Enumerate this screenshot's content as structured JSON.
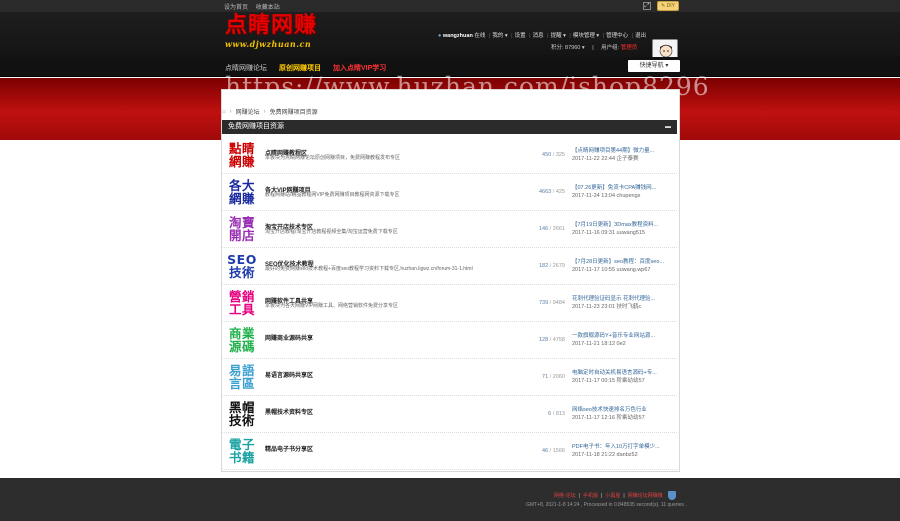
{
  "topbar": {
    "set_home": "设为首页",
    "bookmark": "收藏本站",
    "diy": "DIY"
  },
  "logo": {
    "text": "点睛网赚",
    "url": "www.djwzhuan.cn"
  },
  "user": {
    "username": "wangzhuan",
    "status": "在线",
    "menu": [
      "我的",
      "设置",
      "消息",
      "提醒",
      "模块管理",
      "管理中心",
      "退出"
    ],
    "points_label": "积分: 87960",
    "group_label": "用户组:",
    "group_value": "管理员"
  },
  "nav": {
    "items": [
      "点睛网赚论坛",
      "原创网赚项目",
      "加入点睛VIP学习"
    ],
    "quick_nav": "快捷导航"
  },
  "watermark": "https://www.huzhan.com/ishop8296",
  "breadcrumb": {
    "items": [
      "网赚论坛",
      "免费网赚项目资源"
    ]
  },
  "category": {
    "title": "免费网赚项目资源"
  },
  "forums": [
    {
      "icon_lines": [
        "點睛",
        "網賺"
      ],
      "icon_color": "#cc0000",
      "name": "点睛网赚教程区",
      "desc": "本板块为点睛网赚论坛原创网赚项目，免费网赚教程发布专区",
      "threads": "450",
      "posts": "325",
      "last_title": "【点睛网赚项目第44期】微力量...",
      "last_time": "2017-11-22 22:44 企子泰赛"
    },
    {
      "icon_lines": [
        "各大",
        "網賺"
      ],
      "icon_color": "#1a2aa0",
      "name": "各大VIP网赚项目",
      "desc": "教程网赚站/精品教程网VIP免费网赚项目教程网资源下载专区",
      "threads": "4663",
      "posts": "425",
      "last_title": "【07.26更新】免流卡CPA赚钱网...",
      "last_time": "2017-11-24 13:04 chupengs"
    },
    {
      "icon_lines": [
        "淘寶",
        "開店"
      ],
      "icon_color": "#9a2fb5",
      "name": "淘宝开店技术专区",
      "desc": "淘宝开店教程/淘宝开店教程视频全集/淘宝运营免费下载专区",
      "threads": "146",
      "posts": "2661",
      "last_title": "【7月19日更新】3Dmax教程资料...",
      "last_time": "2017-11-16 09:31 uuwang515"
    },
    {
      "icon_lines": [
        "SEO",
        "技術"
      ],
      "icon_color": "#1f3cad",
      "name": "SEO优化技术教程",
      "desc": "最好的免费网赚seo技术教程+百度seo教程学习资料下载专区,huzhan.ligwz.cn/forum-31-1.html",
      "threads": "182",
      "posts": "2679",
      "last_title": "【7月28日更新】seo教程：百度seo...",
      "last_time": "2017-11-17 10:55 uuwang.wp67"
    },
    {
      "icon_lines": [
        "營銷",
        "工具"
      ],
      "icon_color": "#e6007e",
      "name": "网赚软件工具共享",
      "desc": "本板块为各大网赚VIP网赚工具、网络营销软件免费分享专区",
      "threads": "739",
      "posts": "9484",
      "last_title": "花刺代理验证码显示 花刺代理验...",
      "last_time": "2017-11-23 23:01 扶时飞鹤c"
    },
    {
      "icon_lines": [
        "商業",
        "源碼"
      ],
      "icon_color": "#22b14c",
      "name": "网赚商业源码共享",
      "desc": "",
      "threads": "128",
      "posts": "4758",
      "last_title": "一款旗舰源码Y+音乐专业网站源...",
      "last_time": "2017-11-21 18:12 0e2"
    },
    {
      "icon_lines": [
        "易語",
        "言區"
      ],
      "icon_color": "#3aa0d0",
      "name": "易语言源码共享区",
      "desc": "",
      "threads": "71",
      "posts": "2060",
      "last_title": "电脑定时自动关机易语言源码+专...",
      "last_time": "2017-11-17 00:15 阶乘幼幼57"
    },
    {
      "icon_lines": [
        "黑帽",
        "技術"
      ],
      "icon_color": "#111111",
      "name": "黑帽技术资料专区",
      "desc": "",
      "threads": "6",
      "posts": "813",
      "last_title": "网络seo技术快速排名万色行业",
      "last_time": "2017-11-17 12:16 阶乘幼幼57"
    },
    {
      "icon_lines": [
        "電子",
        "书籍"
      ],
      "icon_color": "#1aa3a3",
      "name": "精品电子书分享区",
      "desc": "",
      "threads": "46",
      "posts": "1566",
      "last_title": "PDF电子书：年入10万打字单模少...",
      "last_time": "2017-11-18 21:22 danbz52"
    }
  ],
  "footer": {
    "links": [
      "网络·论坛",
      "手机版",
      "小黑屋",
      "网赚论坛网赚赚"
    ],
    "version": "GMT+8, 2021-1-8 14:24 , Processed in 0.848535 second(s), 11 queries ."
  }
}
